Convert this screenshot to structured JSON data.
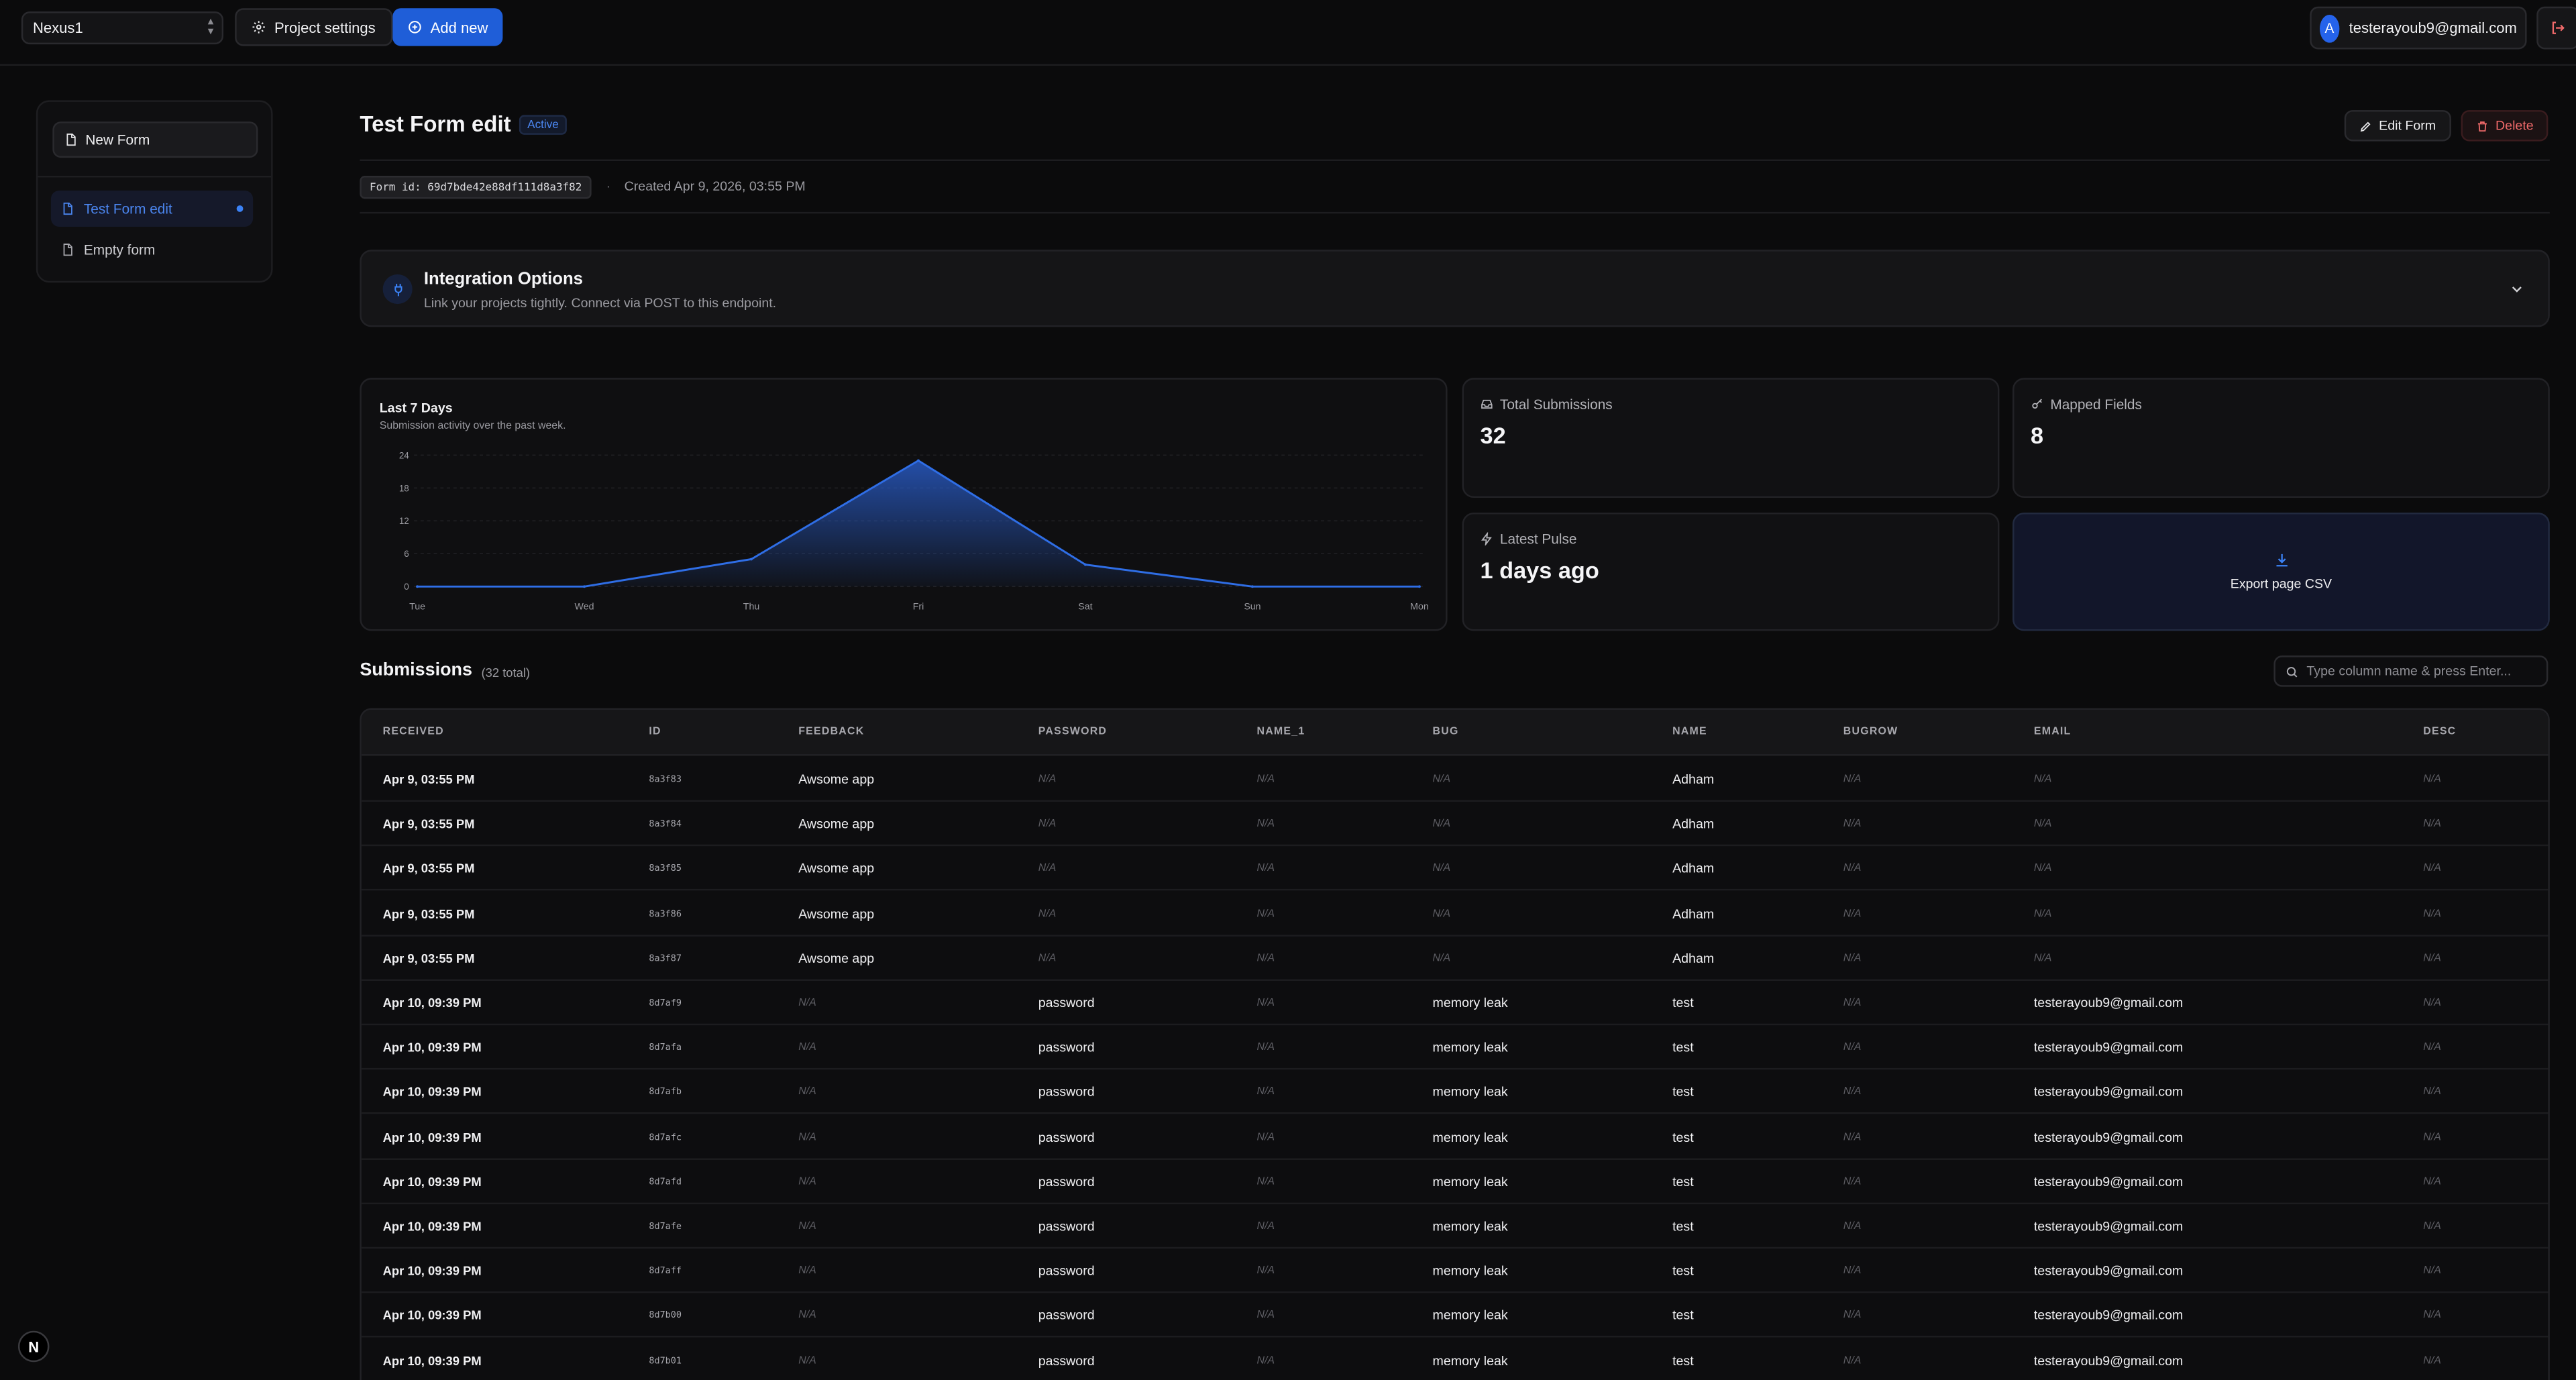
{
  "topbar": {
    "project": "Nexus1",
    "project_settings_label": "Project settings",
    "add_new_label": "Add new",
    "user_initial": "A",
    "user_email": "testerayoub9@gmail.com"
  },
  "sidebar": {
    "new_form_label": "New Form",
    "items": [
      {
        "label": "Test Form edit"
      },
      {
        "label": "Empty form"
      }
    ]
  },
  "header": {
    "title": "Test Form edit",
    "status": "Active",
    "edit_label": "Edit Form",
    "delete_label": "Delete",
    "form_id": "Form id: 69d7bde42e88df111d8a3f82",
    "separator": "·",
    "created": "Created Apr 9, 2026, 03:55 PM"
  },
  "integration": {
    "title": "Integration Options",
    "subtitle": "Link your projects tightly. Connect via POST to this endpoint."
  },
  "chart_data": {
    "type": "area",
    "title": "Last 7 Days",
    "subtitle": "Submission activity over the past week.",
    "categories": [
      "Tue",
      "Wed",
      "Thu",
      "Fri",
      "Sat",
      "Sun",
      "Mon"
    ],
    "values": [
      0,
      0,
      5,
      23,
      4,
      0,
      0
    ],
    "yticks": [
      24,
      18,
      12,
      6,
      0
    ],
    "ylim": [
      0,
      24
    ],
    "grid": true
  },
  "stats": {
    "total_label": "Total Submissions",
    "total_value": "32",
    "mapped_label": "Mapped Fields",
    "mapped_value": "8",
    "pulse_label": "Latest Pulse",
    "pulse_value": "1 days ago",
    "export_label": "Export page CSV"
  },
  "submissions": {
    "title": "Submissions",
    "count": "(32 total)",
    "search_placeholder": "Type column name & press Enter...",
    "columns": [
      "RECEIVED",
      "ID",
      "FEEDBACK",
      "PASSWORD",
      "NAME_1",
      "BUG",
      "NAME",
      "BUGROW",
      "EMAIL",
      "DESC"
    ],
    "rows": [
      [
        "Apr 9, 03:55 PM",
        "8a3f83",
        "Awsome app",
        "N/A",
        "N/A",
        "N/A",
        "Adham",
        "N/A",
        "N/A",
        "N/A"
      ],
      [
        "Apr 9, 03:55 PM",
        "8a3f84",
        "Awsome app",
        "N/A",
        "N/A",
        "N/A",
        "Adham",
        "N/A",
        "N/A",
        "N/A"
      ],
      [
        "Apr 9, 03:55 PM",
        "8a3f85",
        "Awsome app",
        "N/A",
        "N/A",
        "N/A",
        "Adham",
        "N/A",
        "N/A",
        "N/A"
      ],
      [
        "Apr 9, 03:55 PM",
        "8a3f86",
        "Awsome app",
        "N/A",
        "N/A",
        "N/A",
        "Adham",
        "N/A",
        "N/A",
        "N/A"
      ],
      [
        "Apr 9, 03:55 PM",
        "8a3f87",
        "Awsome app",
        "N/A",
        "N/A",
        "N/A",
        "Adham",
        "N/A",
        "N/A",
        "N/A"
      ],
      [
        "Apr 10, 09:39 PM",
        "8d7af9",
        "N/A",
        "password",
        "N/A",
        "memory leak",
        "test",
        "N/A",
        "testerayoub9@gmail.com",
        "N/A"
      ],
      [
        "Apr 10, 09:39 PM",
        "8d7afa",
        "N/A",
        "password",
        "N/A",
        "memory leak",
        "test",
        "N/A",
        "testerayoub9@gmail.com",
        "N/A"
      ],
      [
        "Apr 10, 09:39 PM",
        "8d7afb",
        "N/A",
        "password",
        "N/A",
        "memory leak",
        "test",
        "N/A",
        "testerayoub9@gmail.com",
        "N/A"
      ],
      [
        "Apr 10, 09:39 PM",
        "8d7afc",
        "N/A",
        "password",
        "N/A",
        "memory leak",
        "test",
        "N/A",
        "testerayoub9@gmail.com",
        "N/A"
      ],
      [
        "Apr 10, 09:39 PM",
        "8d7afd",
        "N/A",
        "password",
        "N/A",
        "memory leak",
        "test",
        "N/A",
        "testerayoub9@gmail.com",
        "N/A"
      ],
      [
        "Apr 10, 09:39 PM",
        "8d7afe",
        "N/A",
        "password",
        "N/A",
        "memory leak",
        "test",
        "N/A",
        "testerayoub9@gmail.com",
        "N/A"
      ],
      [
        "Apr 10, 09:39 PM",
        "8d7aff",
        "N/A",
        "password",
        "N/A",
        "memory leak",
        "test",
        "N/A",
        "testerayoub9@gmail.com",
        "N/A"
      ],
      [
        "Apr 10, 09:39 PM",
        "8d7b00",
        "N/A",
        "password",
        "N/A",
        "memory leak",
        "test",
        "N/A",
        "testerayoub9@gmail.com",
        "N/A"
      ],
      [
        "Apr 10, 09:39 PM",
        "8d7b01",
        "N/A",
        "password",
        "N/A",
        "memory leak",
        "test",
        "N/A",
        "testerayoub9@gmail.com",
        "N/A"
      ]
    ]
  },
  "footer": {
    "logo_letter": "N"
  }
}
